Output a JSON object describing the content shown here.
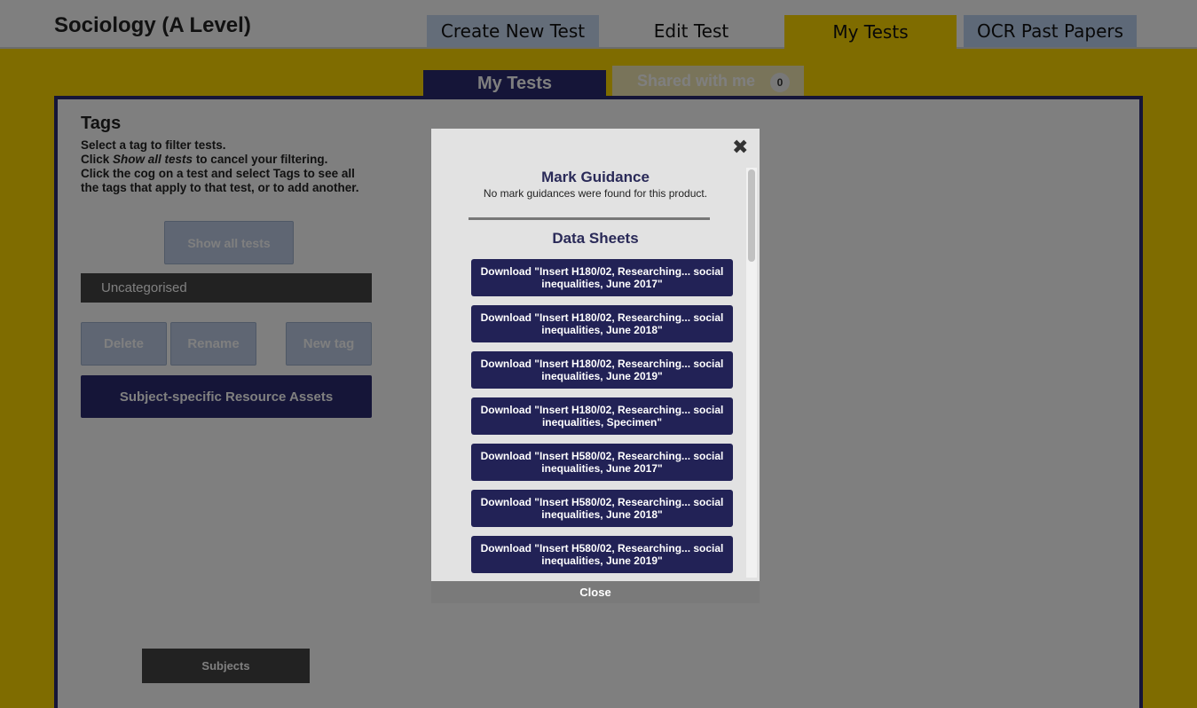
{
  "header": {
    "title": "Sociology (A Level)",
    "tabs": [
      {
        "label": "Create New Test"
      },
      {
        "label": "Edit Test"
      },
      {
        "label": "My Tests"
      },
      {
        "label": "OCR Past Papers"
      }
    ]
  },
  "subtabs": {
    "my_tests": "My Tests",
    "shared": "Shared with me",
    "shared_count": "0"
  },
  "sidebar": {
    "title": "Tags",
    "help_line1": "Select a tag to filter tests.",
    "help_line2_pre": "Click ",
    "help_line2_em": "Show all tests",
    "help_line2_post": " to cancel your filtering.",
    "help_line3": "Click the cog on a test and select Tags to see all the tags that apply to that test, or to add another.",
    "show_all": "Show all tests",
    "uncategorised": "Uncategorised",
    "delete": "Delete",
    "rename": "Rename",
    "new_tag": "New tag",
    "assets": "Subject-specific Resource Assets",
    "subjects": "Subjects"
  },
  "modal": {
    "close_x": "✖",
    "mark_guidance_title": "Mark Guidance",
    "mark_guidance_text": "No mark guidances were found for this product.",
    "data_sheets_title": "Data Sheets",
    "downloads": [
      "Download \"Insert H180/02, Researching... social inequalities, June 2017\"",
      "Download \"Insert H180/02, Researching... social inequalities, June 2018\"",
      "Download \"Insert H180/02, Researching... social inequalities, June 2019\"",
      "Download \"Insert H180/02, Researching... social inequalities, Specimen\"",
      "Download \"Insert H580/02, Researching... social inequalities, June 2017\"",
      "Download \"Insert H580/02, Researching... social inequalities, June 2018\"",
      "Download \"Insert H580/02, Researching... social inequalities, June 2019\""
    ],
    "footer_close": "Close"
  }
}
